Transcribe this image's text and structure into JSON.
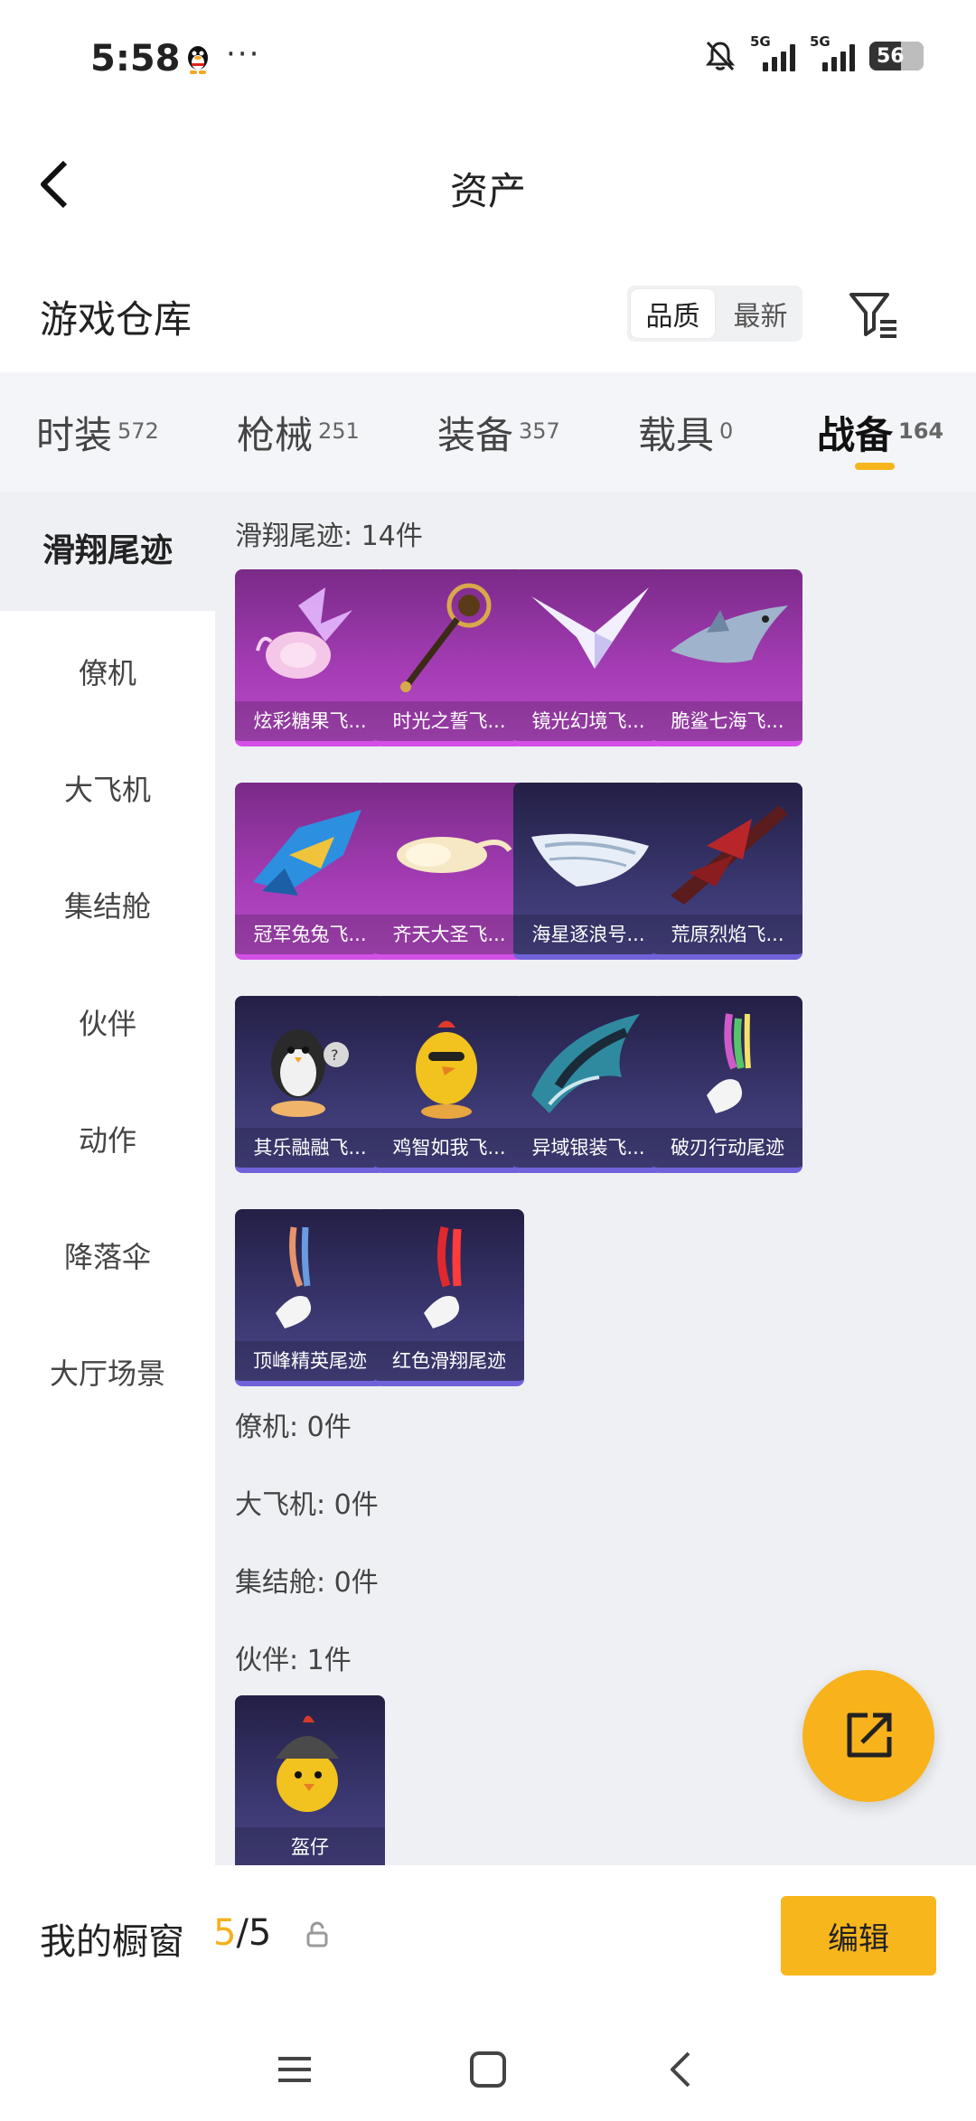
{
  "status_bar": {
    "time": "5:58",
    "more": "···",
    "network_1": "5G",
    "network_2": "5G",
    "battery": "56"
  },
  "header": {
    "title": "资产"
  },
  "warehouse": {
    "title": "游戏仓库",
    "sort_options": [
      "品质",
      "最新"
    ],
    "active_sort": "品质"
  },
  "tabs": [
    {
      "label": "时装",
      "count": "572"
    },
    {
      "label": "枪械",
      "count": "251"
    },
    {
      "label": "装备",
      "count": "357"
    },
    {
      "label": "载具",
      "count": "0"
    },
    {
      "label": "战备",
      "count": "164",
      "active": true
    }
  ],
  "sidebar": {
    "items": [
      "滑翔尾迹",
      "僚机",
      "大飞机",
      "集结舱",
      "伙伴",
      "动作",
      "降落伞",
      "大厅场景"
    ],
    "active": "滑翔尾迹"
  },
  "sections": {
    "glide": {
      "label": "滑翔尾迹: 14件",
      "items": [
        {
          "name": "炫彩糖果飞...",
          "rarity": "pink",
          "icon": "candy-wing-icon"
        },
        {
          "name": "时光之誓飞...",
          "rarity": "pink",
          "icon": "golden-scepter-icon"
        },
        {
          "name": "镜光幻境飞...",
          "rarity": "pink",
          "icon": "crystal-wing-icon"
        },
        {
          "name": "脆鲨七海飞...",
          "rarity": "pink",
          "icon": "shark-glider-icon"
        },
        {
          "name": "冠军兔兔飞...",
          "rarity": "pink",
          "icon": "mecha-glider-icon"
        },
        {
          "name": "齐天大圣飞...",
          "rarity": "pink",
          "icon": "cloud-icon"
        },
        {
          "name": "海星逐浪号...",
          "rarity": "blue",
          "icon": "boat-icon"
        },
        {
          "name": "荒原烈焰飞...",
          "rarity": "blue",
          "icon": "flame-glider-icon"
        },
        {
          "name": "其乐融融飞...",
          "rarity": "blue",
          "icon": "penguin-icon"
        },
        {
          "name": "鸡智如我飞...",
          "rarity": "blue",
          "icon": "chicken-icon"
        },
        {
          "name": "异域银装飞...",
          "rarity": "blue",
          "icon": "silver-wing-icon"
        },
        {
          "name": "破刃行动尾迹",
          "rarity": "blue",
          "icon": "rainbow-trail-icon"
        },
        {
          "name": "顶峰精英尾迹",
          "rarity": "blue",
          "icon": "blue-trail-icon"
        },
        {
          "name": "红色滑翔尾迹",
          "rarity": "blue",
          "icon": "red-trail-icon"
        }
      ]
    },
    "wingman": {
      "label": "僚机: 0件"
    },
    "plane": {
      "label": "大飞机: 0件"
    },
    "capsule": {
      "label": "集结舱: 0件"
    },
    "partner": {
      "label": "伙伴: 1件",
      "items": [
        {
          "name": "盔仔",
          "rarity": "blue",
          "icon": "helmet-chick-icon"
        }
      ]
    }
  },
  "window": {
    "title": "我的橱窗",
    "current": "5",
    "total": "/5",
    "edit_label": "编辑"
  },
  "colors": {
    "accent": "#f8b61d",
    "pink_card": "#a63db6",
    "blue_card": "#3a3770",
    "content_bg": "#eef0f4"
  }
}
